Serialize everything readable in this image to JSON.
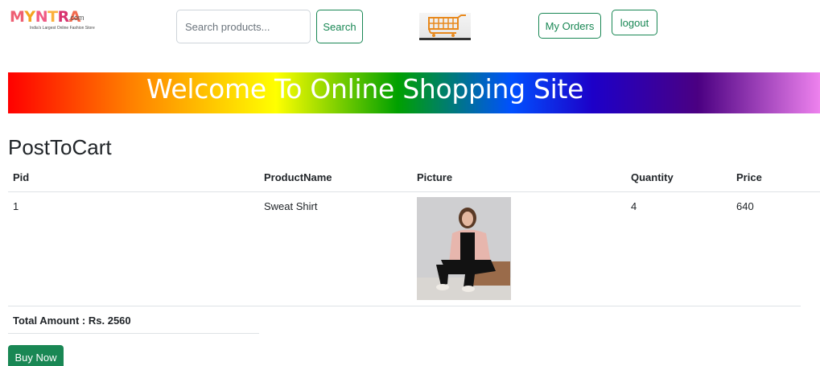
{
  "header": {
    "logo_word": [
      "M",
      "Y",
      "N",
      "T",
      "R",
      "A"
    ],
    "logo_dotcom": ".com",
    "logo_tagline": "India's Largest Online Fashion Store",
    "search_placeholder": "Search products...",
    "search_label": "Search",
    "cart_icon": "shopping-cart-icon",
    "orders_label": "My Orders",
    "logout_label": "logout"
  },
  "banner": {
    "text": "Welcome To Online Shopping Site"
  },
  "main": {
    "title": "PostToCart",
    "columns": [
      "Pid",
      "ProductName",
      "Picture",
      "Quantity",
      "Price"
    ],
    "rows": [
      {
        "pid": "1",
        "product_name": "Sweat Shirt",
        "quantity": "4",
        "price": "640"
      }
    ],
    "total_label": "Total Amount : Rs. 2560",
    "buy_label": "Buy Now"
  },
  "colors": {
    "accent": "#198754",
    "border": "#dee2e6"
  }
}
